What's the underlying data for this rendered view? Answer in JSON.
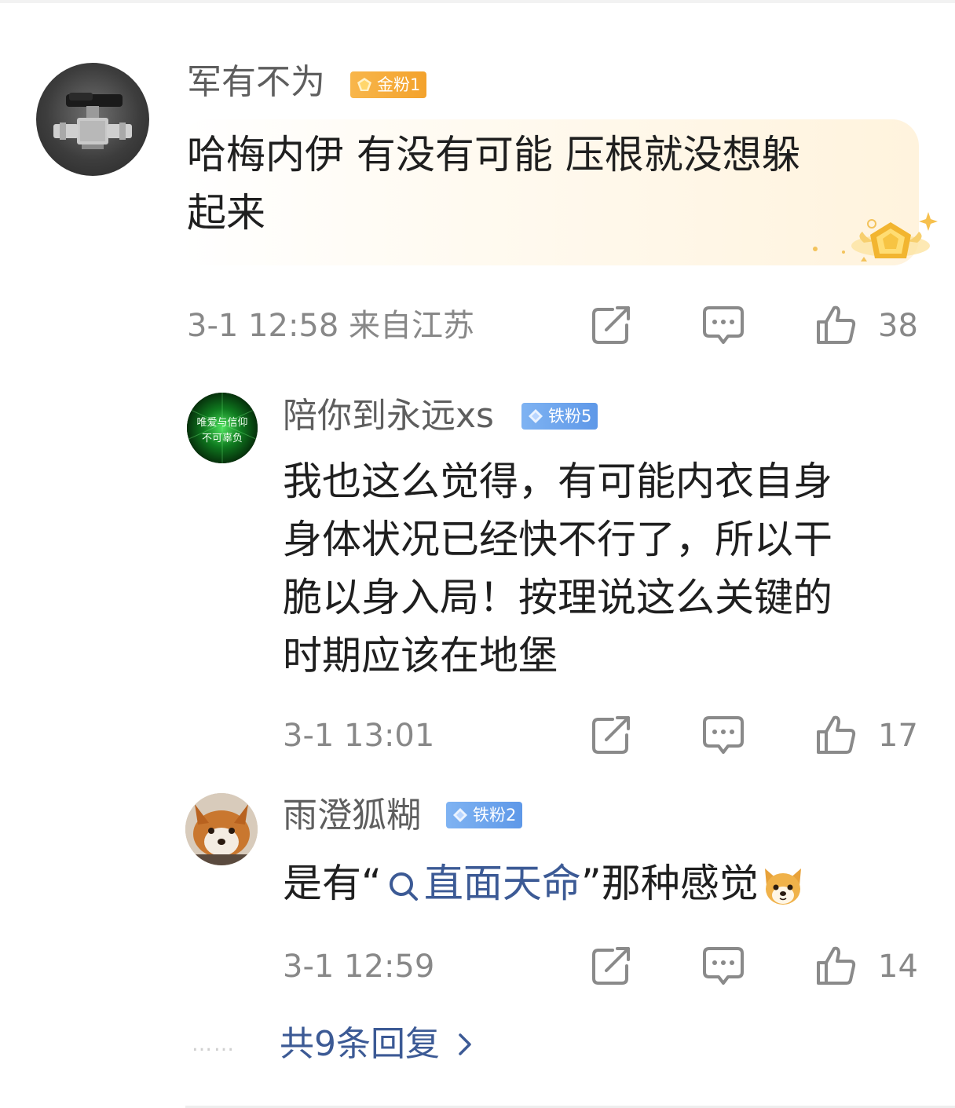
{
  "main_comment": {
    "username": "军有不为",
    "badge": "金粉1",
    "text_line1": "哈梅内伊 有没有可能 压根就没想躲",
    "text_line2": "起来",
    "timestamp": "3-1 12:58 来自江苏",
    "likes": "38"
  },
  "replies": [
    {
      "username": "陪你到永远xs",
      "badge": "铁粉5",
      "avatar_text_line1": "唯爱与信仰",
      "avatar_text_line2": "不可辜负",
      "lines": [
        "我也这么觉得，有可能内衣自身",
        "身体状况已经快不行了，所以干",
        "脆以身入局！按理说这么关键的",
        "时期应该在地堡"
      ],
      "timestamp": "3-1 13:01",
      "likes": "17"
    },
    {
      "username": "雨澄狐糊",
      "badge": "铁粉2",
      "text_prefix": "是有“",
      "topic_link": "直面天命",
      "text_suffix": "”那种感觉",
      "timestamp": "3-1 12:59",
      "likes": "14"
    }
  ],
  "more_replies": {
    "dots": "……",
    "label": "共9条回复"
  },
  "colors": {
    "link": "#3c5a95",
    "meta": "#888888",
    "gold_badge": "#f3a22c",
    "iron_badge": "#5e98e8"
  },
  "icons": [
    "share-icon",
    "comment-icon",
    "like-icon",
    "search-icon",
    "chevron-right-icon",
    "dog-emoji-icon",
    "gold-medal-icon"
  ]
}
